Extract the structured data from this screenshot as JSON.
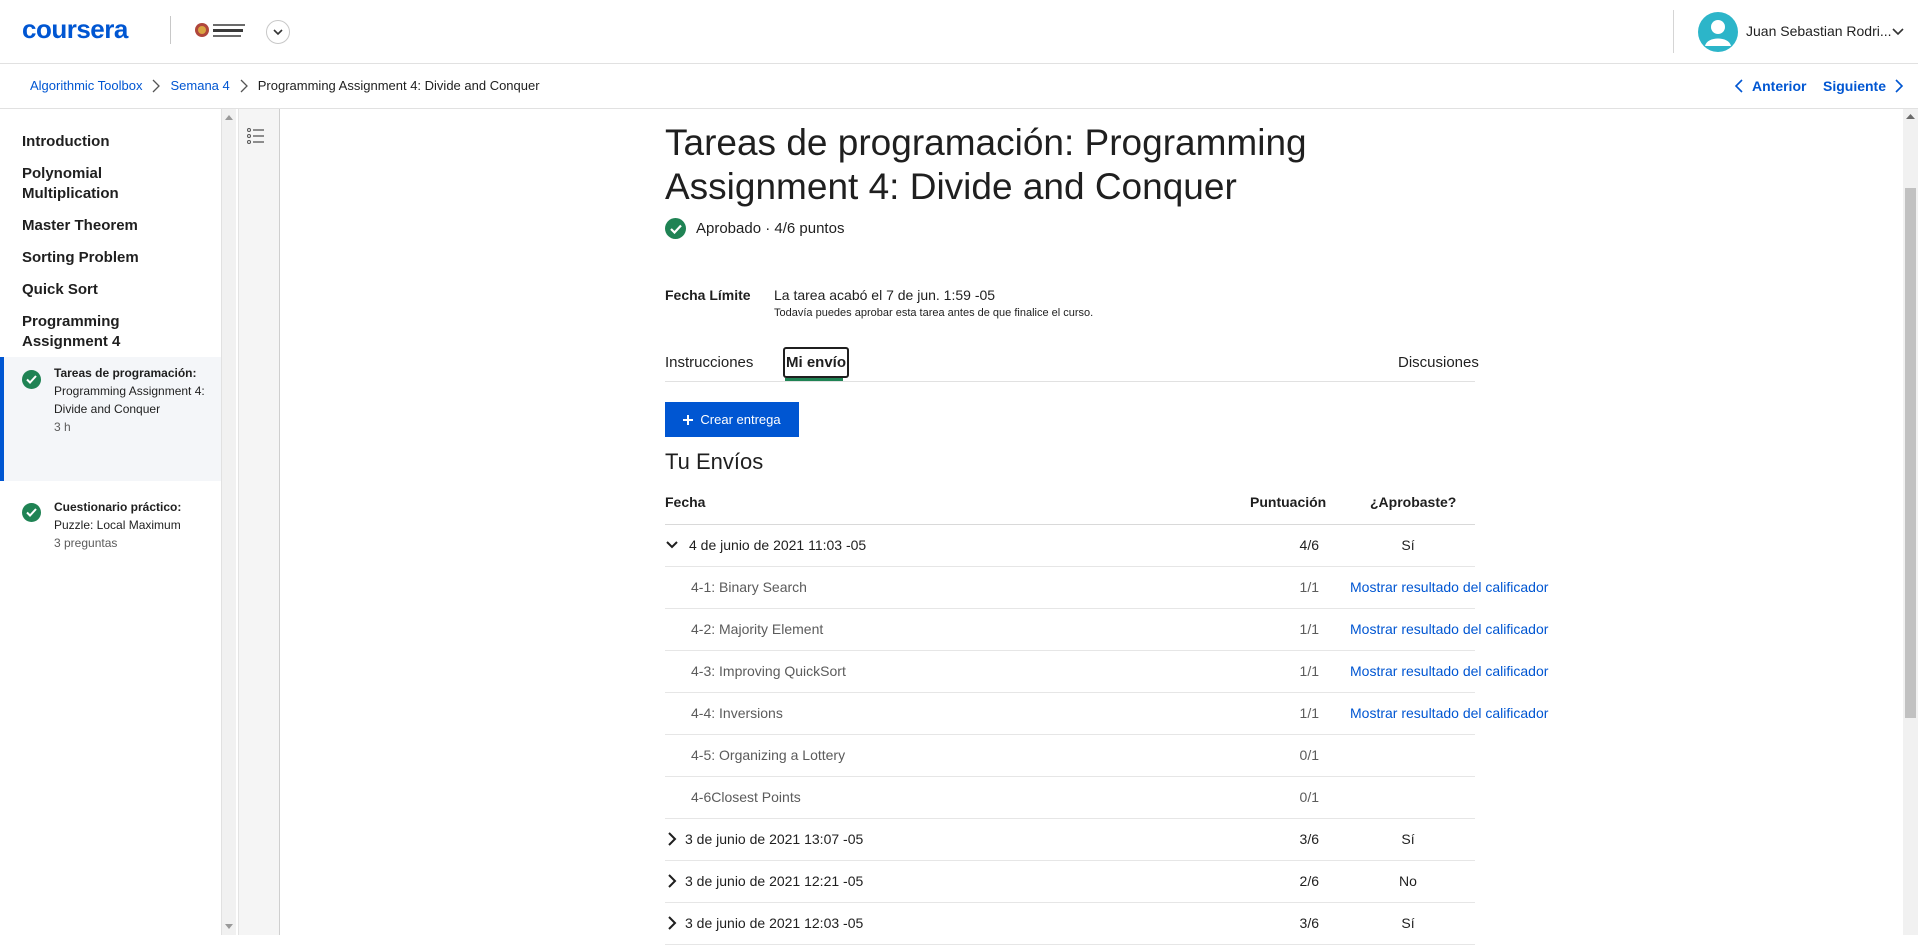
{
  "header": {
    "logo": "coursera",
    "university_logo_alt": "Universidad Nacional de Colombia",
    "user_name": "Juan Sebastian Rodri...",
    "colors": {
      "brand": "#0056d2",
      "avatar": "#2cb5c9",
      "success": "#1f8354"
    }
  },
  "breadcrumb": {
    "items": [
      "Algorithmic Toolbox",
      "Semana 4"
    ],
    "current": "Programming Assignment 4: Divide and Conquer",
    "prev_label": "Anterior",
    "next_label": "Siguiente"
  },
  "sidebar": {
    "sections": [
      {
        "label": "Introduction"
      },
      {
        "label": "Polynomial Multiplication"
      },
      {
        "label": "Master Theorem"
      },
      {
        "label": "Sorting Problem"
      },
      {
        "label": "Quick Sort"
      },
      {
        "label": "Programming Assignment 4"
      }
    ],
    "items": [
      {
        "type": "Tareas de programación:",
        "title": "Programming Assignment 4: Divide and Conquer",
        "meta": "3 h",
        "completed": true,
        "active": true
      },
      {
        "type": "Cuestionario práctico:",
        "title": "Puzzle: Local Maximum",
        "meta": "3 preguntas",
        "completed": true,
        "active": false
      }
    ]
  },
  "main": {
    "title": "Tareas de programación: Programming Assignment 4: Divide and Conquer",
    "status": "Aprobado · 4/6 puntos",
    "deadline_label": "Fecha Límite",
    "deadline_text": "La tarea acabó el 7 de jun. 1:59 -05",
    "deadline_sub": "Todavía puedes aprobar esta tarea antes de que finalice el curso.",
    "tabs": {
      "instructions": "Instrucciones",
      "submission": "Mi envío",
      "discussions": "Discusiones"
    },
    "create_button": "Crear entrega",
    "section_title": "Tu Envíos",
    "table_headers": {
      "date": "Fecha",
      "score": "Puntuación",
      "passed": "¿Aprobaste?"
    },
    "grader_link": "Mostrar resultado del calificador",
    "submissions": [
      {
        "date": "4 de junio de 2021 11:03 -05",
        "score": "4/6",
        "passed": "Sí",
        "expanded": true,
        "parts": [
          {
            "name": "4-1: Binary Search",
            "score": "1/1",
            "has_grader": true
          },
          {
            "name": "4-2: Majority Element",
            "score": "1/1",
            "has_grader": true
          },
          {
            "name": "4-3: Improving QuickSort",
            "score": "1/1",
            "has_grader": true
          },
          {
            "name": "4-4: Inversions",
            "score": "1/1",
            "has_grader": true
          },
          {
            "name": "4-5: Organizing a Lottery",
            "score": "0/1",
            "has_grader": false
          },
          {
            "name": "4-6Closest Points",
            "score": "0/1",
            "has_grader": false
          }
        ]
      },
      {
        "date": "3 de junio de 2021 13:07 -05",
        "score": "3/6",
        "passed": "Sí",
        "expanded": false
      },
      {
        "date": "3 de junio de 2021 12:21 -05",
        "score": "2/6",
        "passed": "No",
        "expanded": false
      },
      {
        "date": "3 de junio de 2021 12:03 -05",
        "score": "3/6",
        "passed": "Sí",
        "expanded": false
      }
    ]
  }
}
